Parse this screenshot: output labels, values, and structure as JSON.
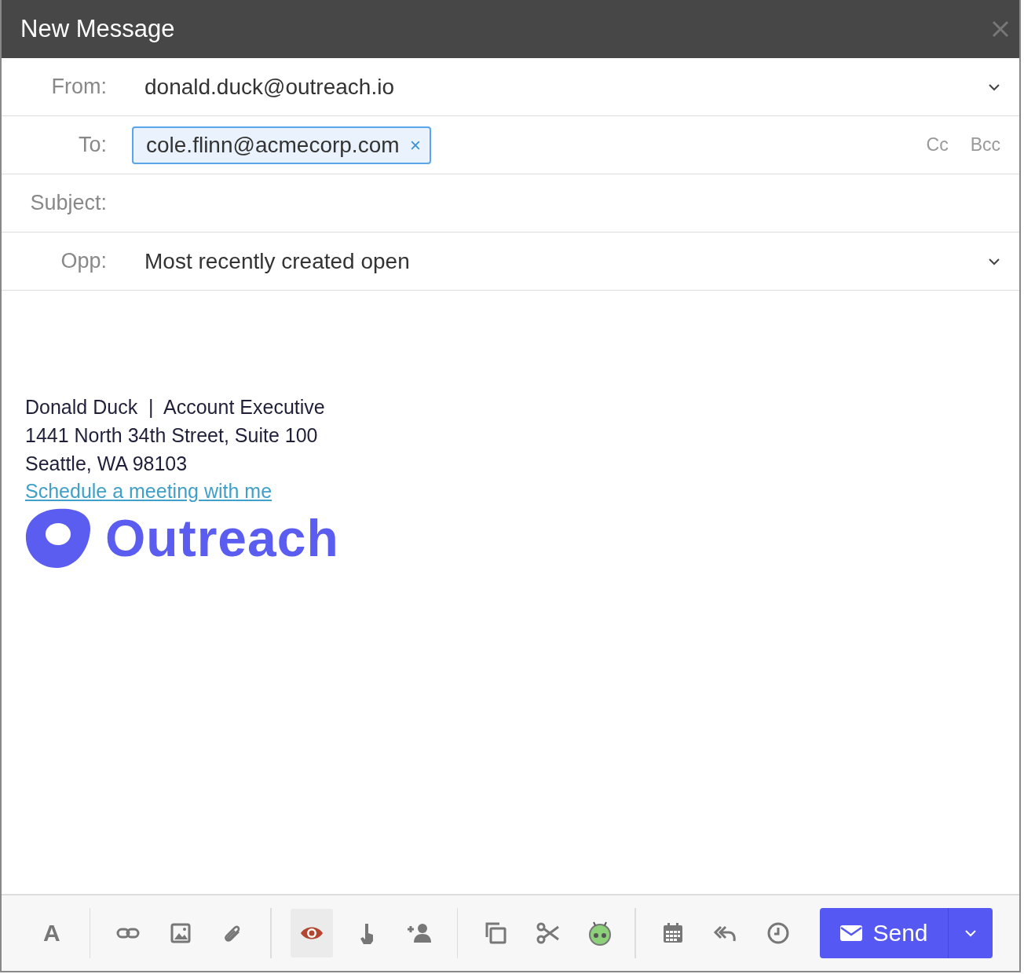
{
  "window": {
    "title": "New Message"
  },
  "fields": [
    {
      "kind": "select",
      "label": "From:",
      "value": "donald.duck@outreach.io"
    },
    {
      "kind": "recipients",
      "label": "To:",
      "chips": [
        "cole.flinn@acmecorp.com"
      ],
      "links": [
        "Cc",
        "Bcc"
      ]
    },
    {
      "kind": "text",
      "label": "Subject:"
    },
    {
      "kind": "select",
      "label": "Opp:",
      "value": "Most recently created open"
    }
  ],
  "signature": {
    "lines": [
      "Donald Duck  |  Account Executive",
      "1441 North 34th Street, Suite 100",
      "Seattle, WA 98103"
    ],
    "link": "Schedule a meeting with me",
    "logo_text": "Outreach"
  },
  "toolbar": {
    "groups": [
      [
        {
          "kind": "font",
          "label": "A",
          "selected": false
        }
      ],
      [
        {
          "kind": "link",
          "selected": false
        },
        {
          "kind": "image",
          "selected": false
        },
        {
          "kind": "attach",
          "selected": false
        }
      ],
      [
        {
          "kind": "eye",
          "selected": true
        },
        {
          "kind": "pointer",
          "selected": false
        },
        {
          "kind": "add-person",
          "selected": false
        }
      ],
      [
        {
          "kind": "copy",
          "selected": false
        },
        {
          "kind": "scissors",
          "selected": false
        },
        {
          "kind": "robot",
          "selected": false
        }
      ],
      [
        {
          "kind": "calendar",
          "selected": false
        },
        {
          "kind": "reply-all",
          "selected": false
        },
        {
          "kind": "clock",
          "selected": false
        }
      ]
    ],
    "send": "Send"
  }
}
